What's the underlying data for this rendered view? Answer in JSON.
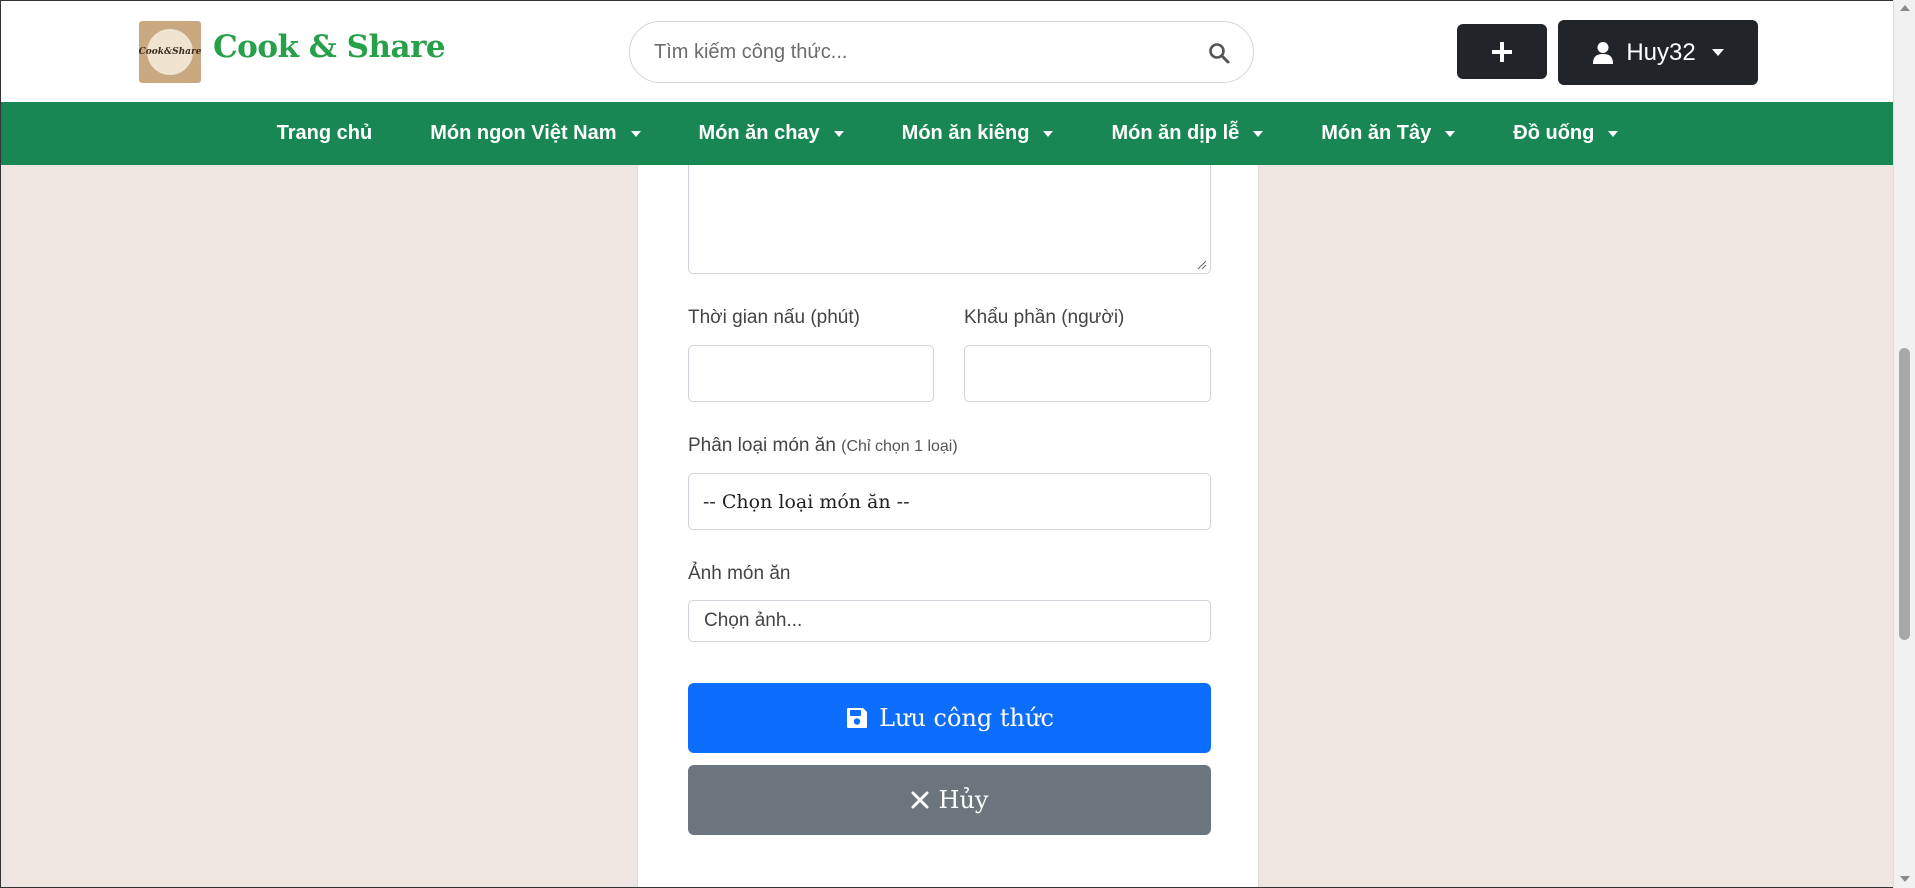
{
  "header": {
    "brand": "Cook & Share",
    "logo_text": "Cook&Share",
    "search_placeholder": "Tìm kiếm công thức...",
    "user_name": "Huy32"
  },
  "nav": {
    "items": [
      {
        "label": "Trang chủ"
      },
      {
        "label": "Món ngon Việt Nam"
      },
      {
        "label": "Món ăn chay"
      },
      {
        "label": "Món ăn kiêng"
      },
      {
        "label": "Món ăn dịp lễ"
      },
      {
        "label": "Món ăn Tây"
      },
      {
        "label": "Đồ uống"
      }
    ]
  },
  "form": {
    "cook_time_label": "Thời gian nấu (phút)",
    "servings_label": "Khẩu phần (người)",
    "category_label": "Phân loại món ăn",
    "category_hint": "(Chỉ chọn 1 loại)",
    "category_selected": "-- Chọn loại món ăn --",
    "image_label": "Ảnh món ăn",
    "image_button": "Chọn ảnh...",
    "save_label": "Lưu công thức",
    "cancel_label": "Hủy"
  },
  "colors": {
    "brand_green": "#27a04a",
    "nav_green": "#198754",
    "primary": "#0d6efd",
    "secondary": "#6c757d",
    "dark": "#212529",
    "page_bg": "#f0e6e1"
  }
}
